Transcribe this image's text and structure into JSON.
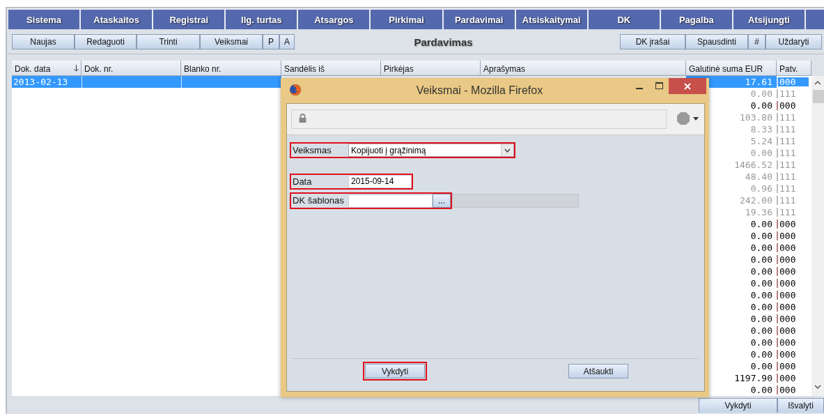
{
  "menu": [
    {
      "label": "Sistema"
    },
    {
      "label": "Ataskaitos"
    },
    {
      "label": "Registrai"
    },
    {
      "label": "Ilg. turtas"
    },
    {
      "label": "Atsargos"
    },
    {
      "label": "Pirkimai"
    },
    {
      "label": "Pardavimai"
    },
    {
      "label": "Atsiskaitymai"
    },
    {
      "label": "DK"
    },
    {
      "label": "Pagalba"
    },
    {
      "label": "Atsijungti"
    }
  ],
  "toolbar": {
    "left_buttons": [
      "Naujas",
      "Redaguoti",
      "Trinti",
      "Veiksmai",
      "P",
      "A"
    ],
    "title": "Pardavimas",
    "right_buttons": [
      "DK įrašai",
      "Spausdinti",
      "#",
      "Uždaryti"
    ]
  },
  "table": {
    "columns": [
      {
        "label": "Dok. data",
        "sorted": true
      },
      {
        "label": "Dok. nr.",
        "sorted": false
      },
      {
        "label": "Blanko nr.",
        "sorted": false
      },
      {
        "label": "Sandėlis iš",
        "sorted": false
      },
      {
        "label": "Pirkėjas",
        "sorted": false
      },
      {
        "label": "Aprašymas",
        "sorted": false
      },
      {
        "label": "Galutinė suma EUR",
        "sorted": false
      },
      {
        "label": "Patv.",
        "sorted": false
      }
    ],
    "rows": [
      {
        "selected": true,
        "dimmed": false,
        "dok_data": "2013-02-13",
        "suma": "17.61",
        "patv": "000"
      },
      {
        "selected": false,
        "dimmed": true,
        "suma": "0.00",
        "patv": "111"
      },
      {
        "selected": false,
        "dimmed": false,
        "suma": "0.00",
        "patv": "000"
      },
      {
        "selected": false,
        "dimmed": true,
        "suma": "103.80",
        "patv": "111"
      },
      {
        "selected": false,
        "dimmed": true,
        "suma": "8.33",
        "patv": "111"
      },
      {
        "selected": false,
        "dimmed": true,
        "suma": "5.24",
        "patv": "111"
      },
      {
        "selected": false,
        "dimmed": true,
        "suma": "0.00",
        "patv": "111"
      },
      {
        "selected": false,
        "dimmed": true,
        "suma": "1466.52",
        "patv": "111"
      },
      {
        "selected": false,
        "dimmed": true,
        "suma": "48.40",
        "patv": "111"
      },
      {
        "selected": false,
        "dimmed": true,
        "suma": "0.96",
        "patv": "111"
      },
      {
        "selected": false,
        "dimmed": true,
        "suma": "242.00",
        "patv": "111"
      },
      {
        "selected": false,
        "dimmed": true,
        "suma": "19.36",
        "patv": "111"
      },
      {
        "selected": false,
        "dimmed": false,
        "suma": "0.00",
        "patv": "000"
      },
      {
        "selected": false,
        "dimmed": false,
        "suma": "0.00",
        "patv": "000"
      },
      {
        "selected": false,
        "dimmed": false,
        "suma": "0.00",
        "patv": "000"
      },
      {
        "selected": false,
        "dimmed": false,
        "suma": "0.00",
        "patv": "000"
      },
      {
        "selected": false,
        "dimmed": false,
        "suma": "0.00",
        "patv": "000"
      },
      {
        "selected": false,
        "dimmed": false,
        "suma": "0.00",
        "patv": "000"
      },
      {
        "selected": false,
        "dimmed": false,
        "suma": "0.00",
        "patv": "000"
      },
      {
        "selected": false,
        "dimmed": false,
        "suma": "0.00",
        "patv": "000"
      },
      {
        "selected": false,
        "dimmed": false,
        "suma": "0.00",
        "patv": "000"
      },
      {
        "selected": false,
        "dimmed": false,
        "suma": "0.00",
        "patv": "000"
      },
      {
        "selected": false,
        "dimmed": false,
        "suma": "0.00",
        "patv": "000"
      },
      {
        "selected": false,
        "dimmed": false,
        "suma": "0.00",
        "patv": "000"
      },
      {
        "selected": false,
        "dimmed": false,
        "suma": "0.00",
        "patv": "000"
      },
      {
        "selected": false,
        "dimmed": false,
        "suma": "1197.90",
        "patv": "000"
      },
      {
        "selected": false,
        "dimmed": false,
        "suma": "0.00",
        "patv": "000"
      }
    ]
  },
  "dialog": {
    "title": "Veiksmai - Mozilla Firefox",
    "fields": [
      {
        "kind": "select",
        "label": "Veiksmas",
        "value": "Kopijuoti į grąžinimą",
        "highlighted": true
      },
      {
        "kind": "text",
        "label": "Data",
        "value": "2015-09-14",
        "highlighted": true
      },
      {
        "kind": "lookup",
        "label": "DK šablonas",
        "button": "...",
        "highlighted": true
      }
    ],
    "buttons": [
      {
        "label": "Vykdyti",
        "highlighted": true
      },
      {
        "label": "Atšaukti",
        "highlighted": false
      }
    ]
  },
  "bottom_buttons": [
    "Vykdyti",
    "Išvalyti"
  ]
}
